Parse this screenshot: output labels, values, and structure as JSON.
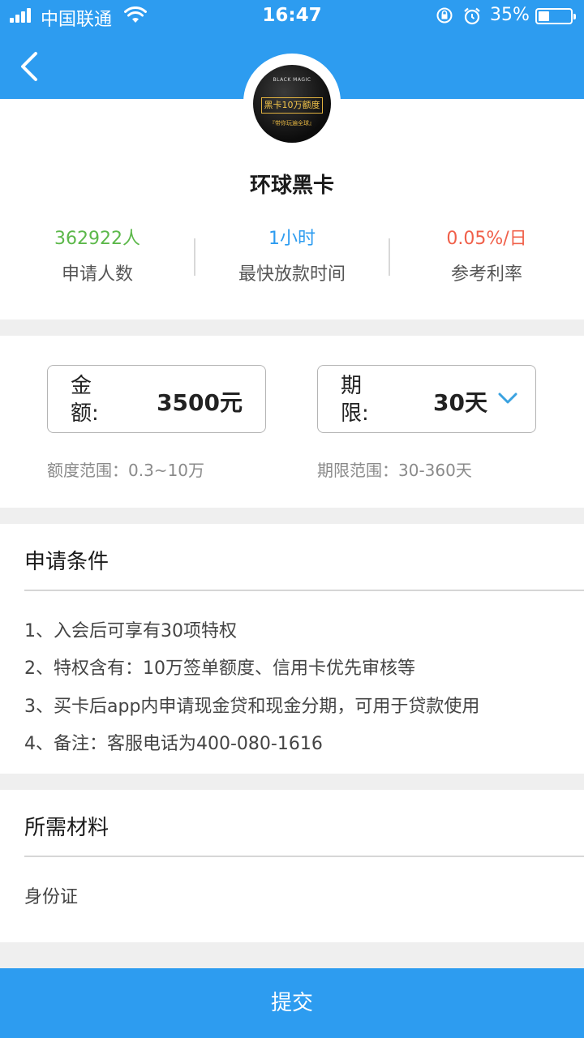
{
  "status_bar": {
    "carrier": "中国联通",
    "time": "16:47",
    "battery": "35%",
    "battery_level": 0.35
  },
  "product": {
    "logo": {
      "brand": "BLACK MAGIC",
      "banner": "黑卡10万额度",
      "slogan": "『带你玩遍全球』"
    },
    "name": "环球黑卡",
    "stats": [
      {
        "value": "362922人",
        "label": "申请人数",
        "color": "#5cb84a"
      },
      {
        "value": "1小时",
        "label": "最快放款时间",
        "color": "#2d9cf0"
      },
      {
        "value": "0.05%/日",
        "label": "参考利率",
        "color": "#f0604a"
      }
    ]
  },
  "loan": {
    "amount_label": "金额:",
    "amount_value": "3500元",
    "amount_range": "额度范围：0.3~10万",
    "term_label": "期限:",
    "term_value": "30天",
    "term_range": "期限范围：30-360天"
  },
  "conditions": {
    "title": "申请条件",
    "items": [
      "1、入会后可享有30项特权",
      "2、特权含有：10万签单额度、信用卡优先审核等",
      "3、买卡后app内申请现金贷和现金分期，可用于贷款使用",
      "4、备注：客服电话为400-080-1616"
    ]
  },
  "materials": {
    "title": "所需材料",
    "items": [
      "身份证"
    ]
  },
  "submit_label": "提交",
  "colors": {
    "primary": "#2d9cf0",
    "background": "#efefef"
  }
}
